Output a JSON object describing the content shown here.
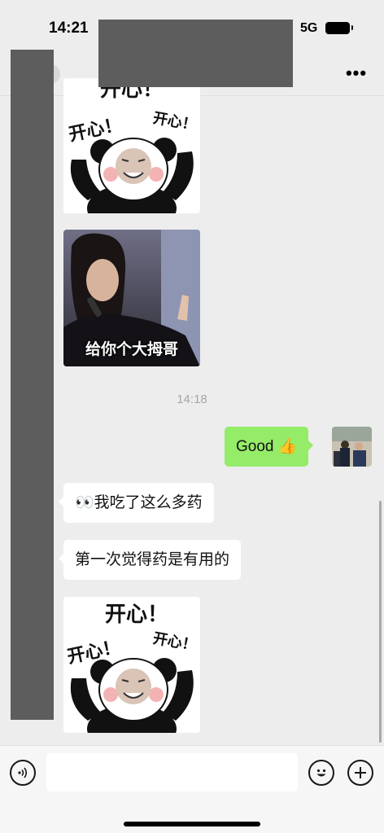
{
  "status_bar": {
    "time": "14:21",
    "network": "5G"
  },
  "header": {
    "more_icon": "more-dots-icon",
    "more_label": "•••"
  },
  "messages": {
    "sticker_top": {
      "line1": "开心！",
      "line2": "开心！",
      "line3": "开心！"
    },
    "photo_sticker_caption": "给你个大拇哥",
    "timestamp": "14:18",
    "outgoing_text": "Good 👍",
    "incoming_1": "👀我吃了这么多药",
    "incoming_2": "第一次觉得药是有用的",
    "sticker_bottom": {
      "line1": "开心！",
      "line2": "开心！",
      "line3": "开心！"
    }
  },
  "input_bar": {
    "voice_icon": "voice-icon",
    "emoji_icon": "emoji-icon",
    "add_icon": "plus-icon",
    "input_value": ""
  },
  "colors": {
    "background": "#ededed",
    "outgoing_bubble": "#95ec69",
    "incoming_bubble": "#ffffff",
    "redaction": "#5d5d5d"
  }
}
